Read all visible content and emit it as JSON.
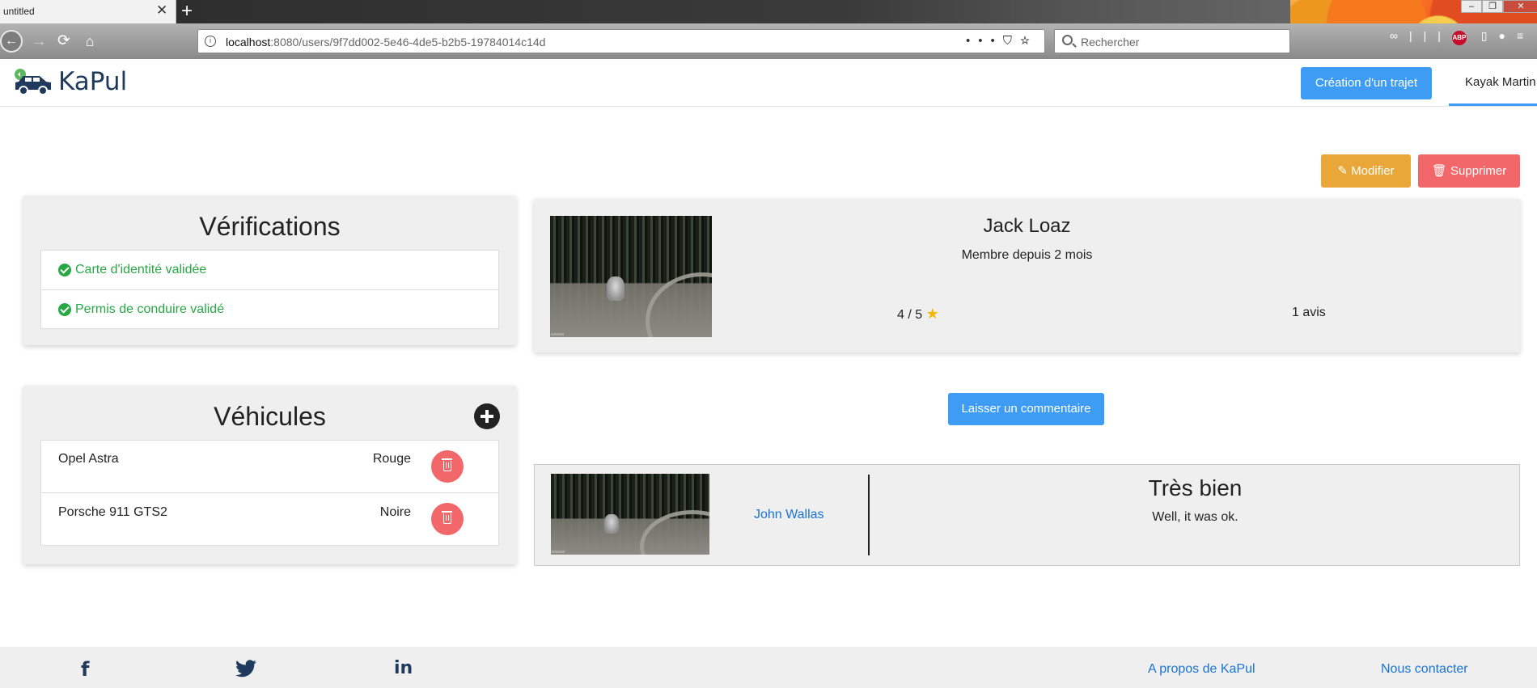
{
  "browser": {
    "tab_title": "untitled",
    "tab_close": "✕",
    "new_tab": "+",
    "url_host": "localhost",
    "url_rest": ":8080/users/9f7dd002-5e46-4de5-b2b5-19784014c14d",
    "search_placeholder": "Rechercher",
    "adblock_badge": "ABP"
  },
  "header": {
    "logo_text": "KaPul",
    "create_trip_label": "Création d'un trajet",
    "user_name": "Kayak Martin"
  },
  "actions": {
    "edit_label": "Modifier",
    "delete_label": "Supprimer"
  },
  "verifications": {
    "title": "Vérifications",
    "items": [
      {
        "label": "Carte d'identité validée",
        "status": "valid"
      },
      {
        "label": "Permis de conduire validé",
        "status": "valid"
      }
    ]
  },
  "vehicles": {
    "title": "Véhicules",
    "items": [
      {
        "name": "Opel Astra",
        "color": "Rouge"
      },
      {
        "name": "Porsche 911 GTS2",
        "color": "Noire"
      }
    ]
  },
  "profile": {
    "name": "Jack Loaz",
    "member_since": "Membre depuis 2 mois",
    "rating_text": "4 / 5",
    "rating_value": 4,
    "rating_max": 5,
    "reviews": "1 avis"
  },
  "comment_button": "Laisser un commentaire",
  "comments": [
    {
      "author": "John Wallas",
      "title": "Très bien",
      "body": "Well, it was ok."
    }
  ],
  "footer": {
    "about": "A propos de KaPul",
    "contact": "Nous contacter",
    "socials": [
      "facebook-icon",
      "twitter-icon",
      "linkedin-icon"
    ]
  },
  "colors": {
    "primary": "#3e9cf5",
    "warning": "#e9a73a",
    "danger": "#f2676a",
    "success": "#28a745",
    "link": "#1a73d1"
  }
}
